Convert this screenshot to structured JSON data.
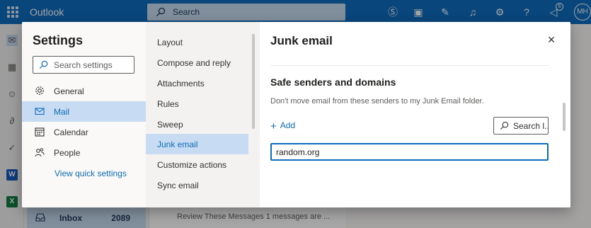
{
  "app": {
    "name": "Outlook",
    "search_label": "Search",
    "notification_count": "6",
    "user_initials": "MH"
  },
  "background": {
    "folder_name": "Inbox",
    "folder_count": "2089",
    "preview_text": "Review These Messages 1 messages are ..."
  },
  "settings": {
    "title": "Settings",
    "search_placeholder": "Search settings",
    "categories": [
      {
        "label": "General",
        "icon": "gear-icon"
      },
      {
        "label": "Mail",
        "icon": "mail-icon"
      },
      {
        "label": "Calendar",
        "icon": "calendar-icon"
      },
      {
        "label": "People",
        "icon": "people-icon"
      }
    ],
    "active_category": "Mail",
    "quick_settings_link": "View quick settings",
    "subcategories": [
      "Layout",
      "Compose and reply",
      "Attachments",
      "Rules",
      "Sweep",
      "Junk email",
      "Customize actions",
      "Sync email"
    ],
    "active_subcategory": "Junk email"
  },
  "panel": {
    "title": "Junk email",
    "close_label": "×",
    "section_title": "Safe senders and domains",
    "section_description": "Don't move email from these senders to my Junk Email folder.",
    "add_label": "Add",
    "search_label": "Search l...",
    "sender_value": "random.org"
  },
  "colors": {
    "accent": "#0f6cbd",
    "selected_background": "#c7dcf2",
    "topbar": "#0f6cbd"
  }
}
